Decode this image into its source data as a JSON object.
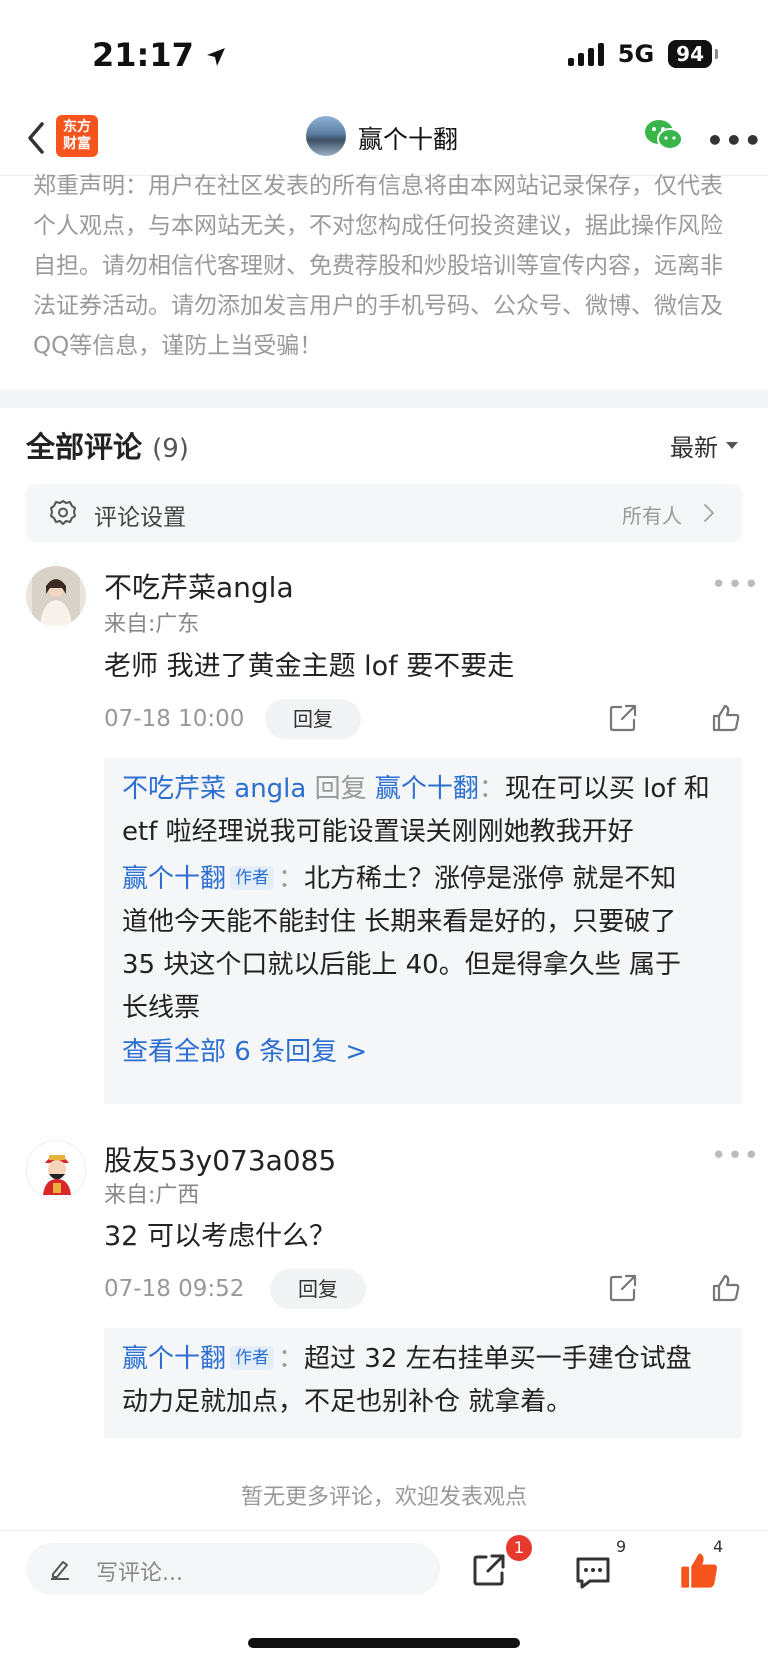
{
  "status_bar": {
    "time": "21:17",
    "network": "5G",
    "battery": "94"
  },
  "nav": {
    "back_icon": "chevron-left-icon",
    "logo_text_1": "东方",
    "logo_text_2": "财富",
    "title": "赢个十翻",
    "wechat_icon": "wechat-icon",
    "more_icon": "more-horizontal-icon"
  },
  "disclaimer": "郑重声明：用户在社区发表的所有信息将由本网站记录保存，仅代表个人观点，与本网站无关，不对您构成任何投资建议，据此操作风险自担。请勿相信代客理财、免费荐股和炒股培训等宣传内容，远离非法证券活动。请勿添加发言用户的手机号码、公众号、微博、微信及QQ等信息，谨防上当受骗！",
  "comments_header": {
    "title": "全部评论",
    "count": "(9)",
    "sort_label": "最新"
  },
  "settings": {
    "label": "评论设置",
    "value": "所有人"
  },
  "comments": [
    {
      "name": "不吃芹菜angla",
      "location": "来自:广东",
      "text": "老师 我进了黄金主题 lof 要不要走",
      "time": "07-18 10:00",
      "reply_label": "回复",
      "replies": {
        "r1_from": "不吃芹菜 angla",
        "r1_verb": "回复",
        "r1_to": "赢个十翻",
        "r1_text_a": "现在可以买 lof 和",
        "r1_text_b": "etf 啦经理说我可能设置误关刚刚她教我开好",
        "r2_from": "赢个十翻",
        "r2_tag": "作者",
        "r2_text_a": "北方稀土？涨停是涨停 就是不知",
        "r2_text_b": "道他今天能不能封住 长期来看是好的，只要破了",
        "r2_text_c": "35 块这个口就以后能上 40。但是得拿久些 属于",
        "r2_text_d": "长线票",
        "view_all": "查看全部 6 条回复 >"
      }
    },
    {
      "name": "股友53y073a085",
      "location": "来自:广西",
      "text": "32 可以考虑什么？",
      "time": "07-18 09:52",
      "reply_label": "回复",
      "replies": {
        "r1_from": "赢个十翻",
        "r1_tag": "作者",
        "r1_text_a": "超过 32 左右挂单买一手建仓试盘",
        "r1_text_b": "动力足就加点，不足也别补仓 就拿着。"
      }
    }
  ],
  "no_more": "暂无更多评论，欢迎发表观点",
  "bottom_bar": {
    "placeholder": "写评论...",
    "share_badge": "1",
    "comment_count": "9",
    "like_count": "4"
  },
  "colors": {
    "accent_orange": "#f5541d",
    "link_blue": "#2c6fd1",
    "badge_red": "#e8392f"
  }
}
